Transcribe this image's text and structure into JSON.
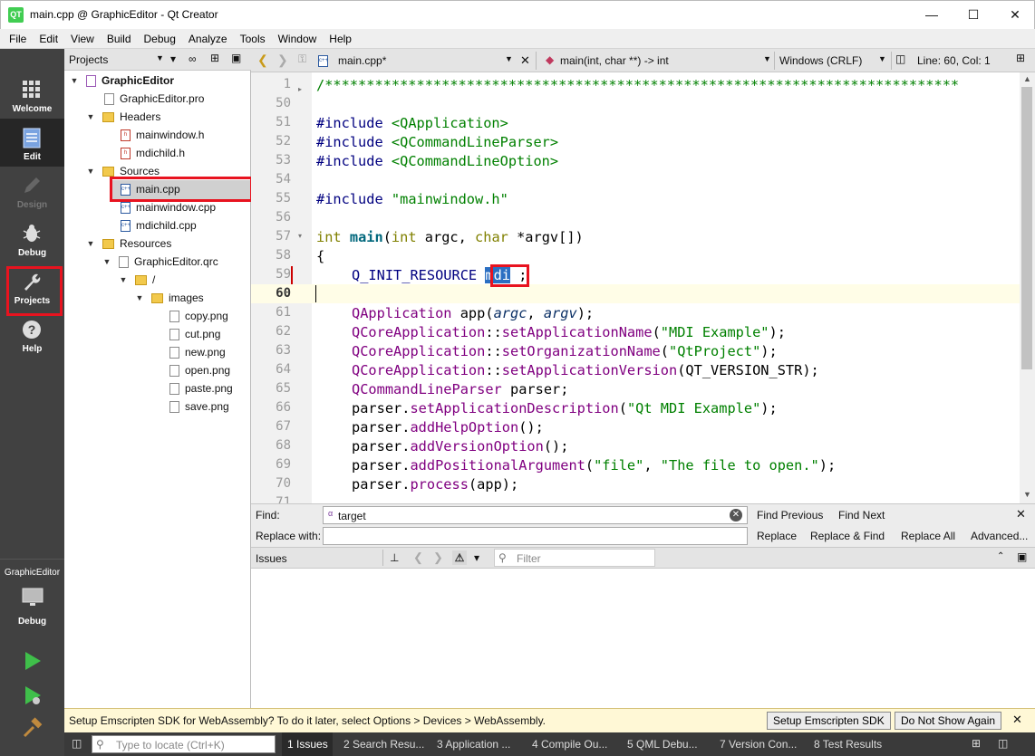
{
  "window": {
    "title": "main.cpp @ GraphicEditor - Qt Creator",
    "logo": "QT"
  },
  "menu": [
    "File",
    "Edit",
    "View",
    "Build",
    "Debug",
    "Analyze",
    "Tools",
    "Window",
    "Help"
  ],
  "modes": [
    {
      "label": "Welcome",
      "icon": "grid-icon"
    },
    {
      "label": "Edit",
      "icon": "document-icon"
    },
    {
      "label": "Design",
      "icon": "pencil-icon"
    },
    {
      "label": "Debug",
      "icon": "bug-icon"
    },
    {
      "label": "Projects",
      "icon": "wrench-icon"
    },
    {
      "label": "Help",
      "icon": "question-icon"
    }
  ],
  "kit": {
    "project": "GraphicEditor",
    "config": "Debug"
  },
  "projects_panel": {
    "title": "Projects"
  },
  "tree": [
    {
      "label": "GraphicEditor"
    },
    {
      "label": "GraphicEditor.pro"
    },
    {
      "label": "Headers"
    },
    {
      "label": "mainwindow.h"
    },
    {
      "label": "mdichild.h"
    },
    {
      "label": "Sources"
    },
    {
      "label": "main.cpp"
    },
    {
      "label": "mainwindow.cpp"
    },
    {
      "label": "mdichild.cpp"
    },
    {
      "label": "Resources"
    },
    {
      "label": "GraphicEditor.qrc"
    },
    {
      "label": "/"
    },
    {
      "label": "images"
    },
    {
      "label": "copy.png"
    },
    {
      "label": "cut.png"
    },
    {
      "label": "new.png"
    },
    {
      "label": "open.png"
    },
    {
      "label": "paste.png"
    },
    {
      "label": "save.png"
    }
  ],
  "editor": {
    "file_tab": "main.cpp*",
    "symbol": "main(int, char **) -> int",
    "line_endings": "Windows (CRLF)",
    "position": "Line: 60, Col: 1"
  },
  "code": {
    "line_numbers": [
      "1",
      "50",
      "51",
      "52",
      "53",
      "54",
      "55",
      "56",
      "57",
      "58",
      "59",
      "60",
      "61",
      "62",
      "63",
      "64",
      "65",
      "66",
      "67",
      "68",
      "69",
      "70",
      "71"
    ],
    "comment_line": "/****************************************************************************",
    "inc1": "#include",
    "inc1_arg": "<QApplication>",
    "inc2": "#include",
    "inc2_arg": "<QCommandLineParser>",
    "inc3": "#include",
    "inc3_arg": "<QCommandLineOption>",
    "inc4": "#include",
    "inc4_arg": "\"mainwindow.h\"",
    "main_int": "int",
    "main_name": "main",
    "main_rest1": "(",
    "main_int2": "int",
    "main_argc": " argc, ",
    "main_char": "char",
    "main_rest2": " *argv[])",
    "brace": "{",
    "l59_macro": "Q_INIT_RESOURCE",
    "l59_arg": "mdi",
    "l59_end": " ;",
    "l61a": "QApplication",
    "l61b": " app(",
    "l61c": "argc",
    "l61d": ", ",
    "l61e": "argv",
    "l61f": ");",
    "l62a": "QCoreApplication",
    "l62b": "::",
    "l62c": "setApplicationName",
    "l62d": "(",
    "l62e": "\"MDI Example\"",
    "l62f": ");",
    "l63a": "QCoreApplication",
    "l63b": "::",
    "l63c": "setOrganizationName",
    "l63d": "(",
    "l63e": "\"QtProject\"",
    "l63f": ");",
    "l64a": "QCoreApplication",
    "l64b": "::",
    "l64c": "setApplicationVersion",
    "l64d": "(QT_VERSION_STR);",
    "l65a": "QCommandLineParser",
    "l65b": " parser;",
    "l66a": "parser.",
    "l66b": "setApplicationDescription",
    "l66c": "(",
    "l66d": "\"Qt MDI Example\"",
    "l66e": ");",
    "l67a": "parser.",
    "l67b": "addHelpOption",
    "l67c": "();",
    "l68a": "parser.",
    "l68b": "addVersionOption",
    "l68c": "();",
    "l69a": "parser.",
    "l69b": "addPositionalArgument",
    "l69c": "(",
    "l69d": "\"file\"",
    "l69e": ", ",
    "l69f": "\"The file to open.\"",
    "l69g": ");",
    "l70a": "parser.",
    "l70b": "process",
    "l70c": "(app);"
  },
  "find": {
    "find_label": "Find:",
    "find_value": "target",
    "replace_label": "Replace with:",
    "replace_value": "",
    "find_previous": "Find Previous",
    "find_next": "Find Next",
    "replace": "Replace",
    "replace_find": "Replace & Find",
    "replace_all": "Replace All",
    "advanced": "Advanced..."
  },
  "issues": {
    "title": "Issues",
    "filter_placeholder": "Filter"
  },
  "infobar": {
    "message": "Setup Emscripten SDK for WebAssembly? To do it later, select Options > Devices > WebAssembly.",
    "setup_button": "Setup Emscripten SDK",
    "dont_show_button": "Do Not Show Again"
  },
  "statusbar": {
    "locator_placeholder": "Type to locate (Ctrl+K)",
    "tabs": [
      "1  Issues",
      "2  Search Resu...",
      "3  Application ...",
      "4  Compile Ou...",
      "5  QML Debu...",
      "7  Version Con...",
      "8  Test Results"
    ]
  },
  "colors": {
    "accent": "#e8131f",
    "qt_green": "#41cd52",
    "sidebar": "#414141"
  }
}
